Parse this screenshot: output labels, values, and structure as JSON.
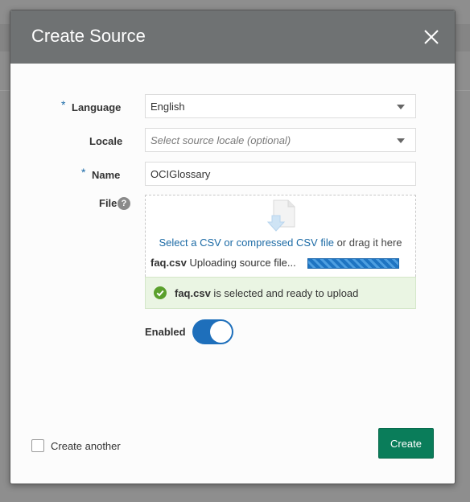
{
  "dialog": {
    "title": "Create Source",
    "close_icon": "close-icon"
  },
  "form": {
    "language": {
      "label": "Language",
      "required_marker": "*",
      "value": "English"
    },
    "locale": {
      "label": "Locale",
      "placeholder": "Select source locale (optional)"
    },
    "name": {
      "label": "Name",
      "required_marker": "*",
      "value": "OCIGlossary"
    },
    "file": {
      "label": "File",
      "help_icon": "?",
      "drop_link": "Select a CSV or compressed CSV file",
      "drop_suffix": " or drag it here",
      "upload_filename": "faq.csv",
      "upload_status": "Uploading source file...",
      "upload_progress": "indeterminate"
    },
    "status": {
      "filename": "faq.csv",
      "message": " is selected and ready to upload"
    },
    "enabled": {
      "label": "Enabled",
      "on": true
    }
  },
  "footer": {
    "create_another_label": "Create another",
    "create_button": "Create"
  },
  "colors": {
    "header_bg": "#6f7273",
    "accent_blue": "#1e6fbb",
    "create_green": "#0a7d5a",
    "success_bg": "#eaf5e3",
    "success_icon": "#5aa02c"
  }
}
